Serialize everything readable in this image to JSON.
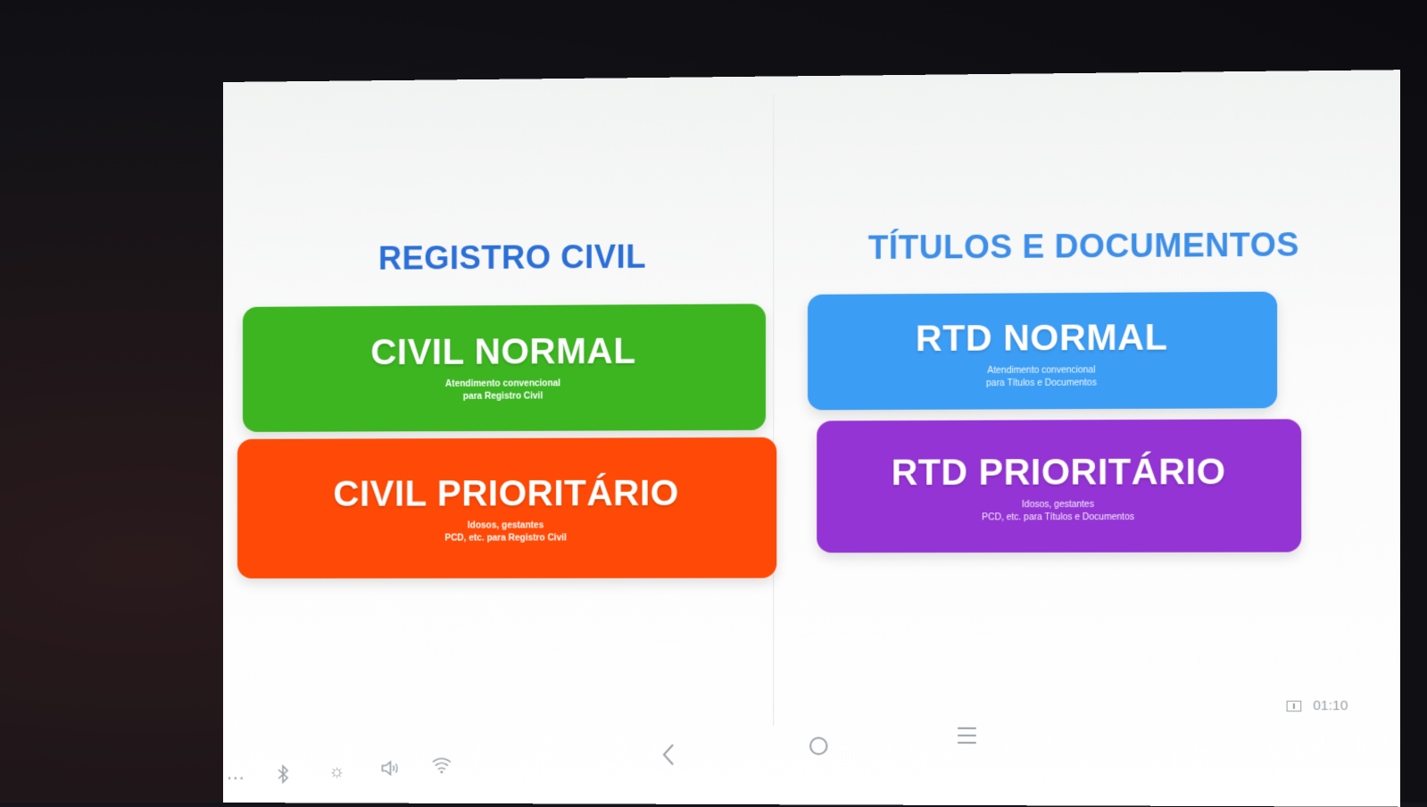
{
  "left_column": {
    "title": "REGISTRO CIVIL",
    "buttons": [
      {
        "label": "CIVIL NORMAL",
        "subtitle_line1": "Atendimento convencional",
        "subtitle_line2": "para Registro Civil",
        "color": "#3cb521"
      },
      {
        "label": "CIVIL PRIORITÁRIO",
        "subtitle_line1": "Idosos, gestantes",
        "subtitle_line2": "PCD, etc. para Registro Civil",
        "color": "#fe4a06"
      }
    ]
  },
  "right_column": {
    "title": "TÍTULOS E DOCUMENTOS",
    "buttons": [
      {
        "label": "RTD NORMAL",
        "subtitle_line1": "Atendimento convencional",
        "subtitle_line2": "para Títulos e Documentos",
        "color": "#3c9df5"
      },
      {
        "label": "RTD PRIORITÁRIO",
        "subtitle_line1": "Idosos, gestantes",
        "subtitle_line2": "PCD, etc. para Títulos e Documentos",
        "color": "#9434d4"
      }
    ]
  },
  "system_bar": {
    "left_icons": [
      "more-icon",
      "bluetooth-icon",
      "brightness-icon",
      "volume-icon",
      "wifi-icon"
    ],
    "nav_icons": [
      "back-icon",
      "home-icon",
      "recents-icon"
    ],
    "time": "01:10"
  }
}
